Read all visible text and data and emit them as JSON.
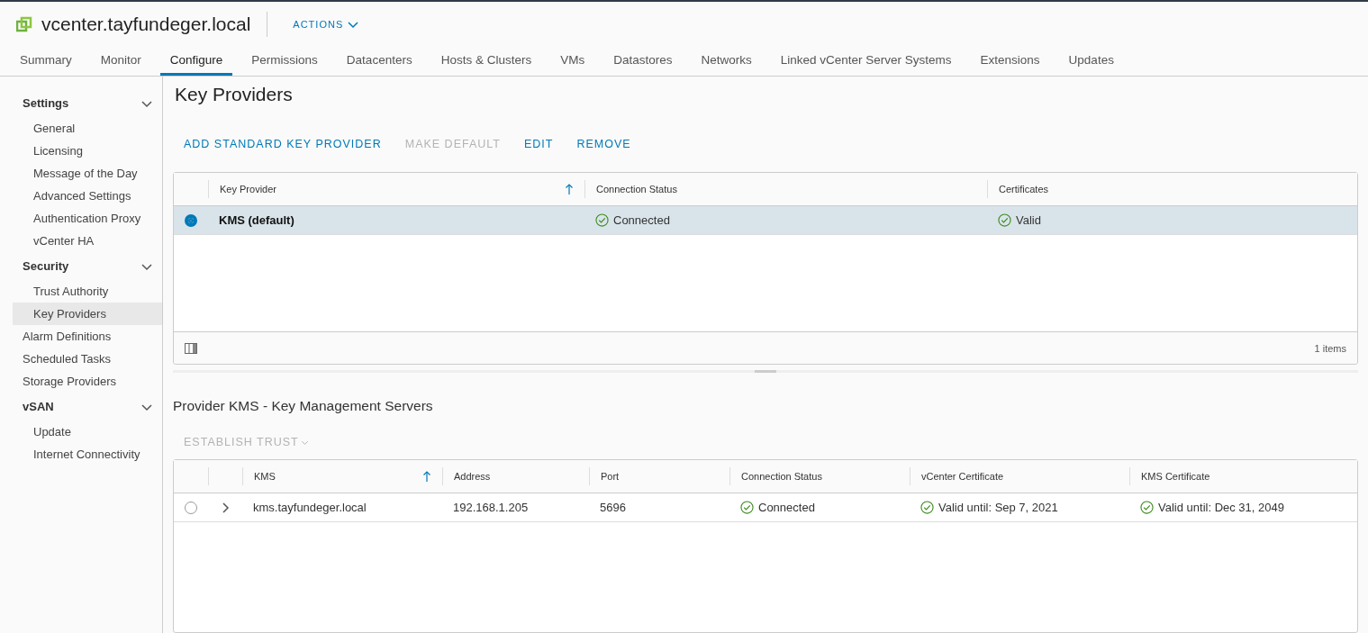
{
  "header": {
    "title": "vcenter.tayfundeger.local",
    "actions": "ACTIONS"
  },
  "tabs": [
    {
      "label": "Summary",
      "selected": false
    },
    {
      "label": "Monitor",
      "selected": false
    },
    {
      "label": "Configure",
      "selected": true
    },
    {
      "label": "Permissions",
      "selected": false
    },
    {
      "label": "Datacenters",
      "selected": false
    },
    {
      "label": "Hosts & Clusters",
      "selected": false
    },
    {
      "label": "VMs",
      "selected": false
    },
    {
      "label": "Datastores",
      "selected": false
    },
    {
      "label": "Networks",
      "selected": false
    },
    {
      "label": "Linked vCenter Server Systems",
      "selected": false
    },
    {
      "label": "Extensions",
      "selected": false
    },
    {
      "label": "Updates",
      "selected": false
    }
  ],
  "sidebar": {
    "items": [
      {
        "kind": "group",
        "label": "Settings",
        "expanded": true,
        "children": [
          {
            "label": "General",
            "selected": false
          },
          {
            "label": "Licensing",
            "selected": false
          },
          {
            "label": "Message of the Day",
            "selected": false
          },
          {
            "label": "Advanced Settings",
            "selected": false
          },
          {
            "label": "Authentication Proxy",
            "selected": false
          },
          {
            "label": "vCenter HA",
            "selected": false
          }
        ]
      },
      {
        "kind": "group",
        "label": "Security",
        "expanded": true,
        "children": [
          {
            "label": "Trust Authority",
            "selected": false
          },
          {
            "label": "Key Providers",
            "selected": true
          }
        ]
      },
      {
        "kind": "item",
        "label": "Alarm Definitions",
        "selected": false
      },
      {
        "kind": "item",
        "label": "Scheduled Tasks",
        "selected": false
      },
      {
        "kind": "item",
        "label": "Storage Providers",
        "selected": false
      },
      {
        "kind": "group",
        "label": "vSAN",
        "expanded": true,
        "children": [
          {
            "label": "Update",
            "selected": false
          },
          {
            "label": "Internet Connectivity",
            "selected": false
          }
        ]
      }
    ]
  },
  "page_title": "Key Providers",
  "toolbar": [
    {
      "label": "ADD STANDARD KEY PROVIDER",
      "disabled": false
    },
    {
      "label": "MAKE DEFAULT",
      "disabled": true
    },
    {
      "label": "EDIT",
      "disabled": false
    },
    {
      "label": "REMOVE",
      "disabled": false
    }
  ],
  "providers_table": {
    "columns": [
      {
        "label": "Key Provider",
        "sorted": true
      },
      {
        "label": "Connection Status",
        "sorted": false
      },
      {
        "label": "Certificates",
        "sorted": false
      }
    ],
    "rows": [
      {
        "selected": true,
        "cells": [
          "KMS (default)",
          "Connected",
          "Valid"
        ]
      }
    ],
    "footer": "1 items"
  },
  "servers_section": {
    "title": "Provider KMS - Key Management Servers",
    "action": {
      "label": "ESTABLISH TRUST",
      "disabled": true
    },
    "columns": [
      {
        "label": "KMS",
        "sorted": true
      },
      {
        "label": "Address",
        "sorted": false
      },
      {
        "label": "Port",
        "sorted": false
      },
      {
        "label": "Connection Status",
        "sorted": false
      },
      {
        "label": "vCenter Certificate",
        "sorted": false
      },
      {
        "label": "KMS Certificate",
        "sorted": false
      }
    ],
    "rows": [
      {
        "selected": false,
        "expanded": false,
        "cells": [
          "kms.tayfundeger.local",
          "192.168.1.205",
          "5696",
          "Connected",
          "Valid until: Sep 7, 2021",
          "Valid until: Dec 31, 2049"
        ]
      }
    ]
  }
}
